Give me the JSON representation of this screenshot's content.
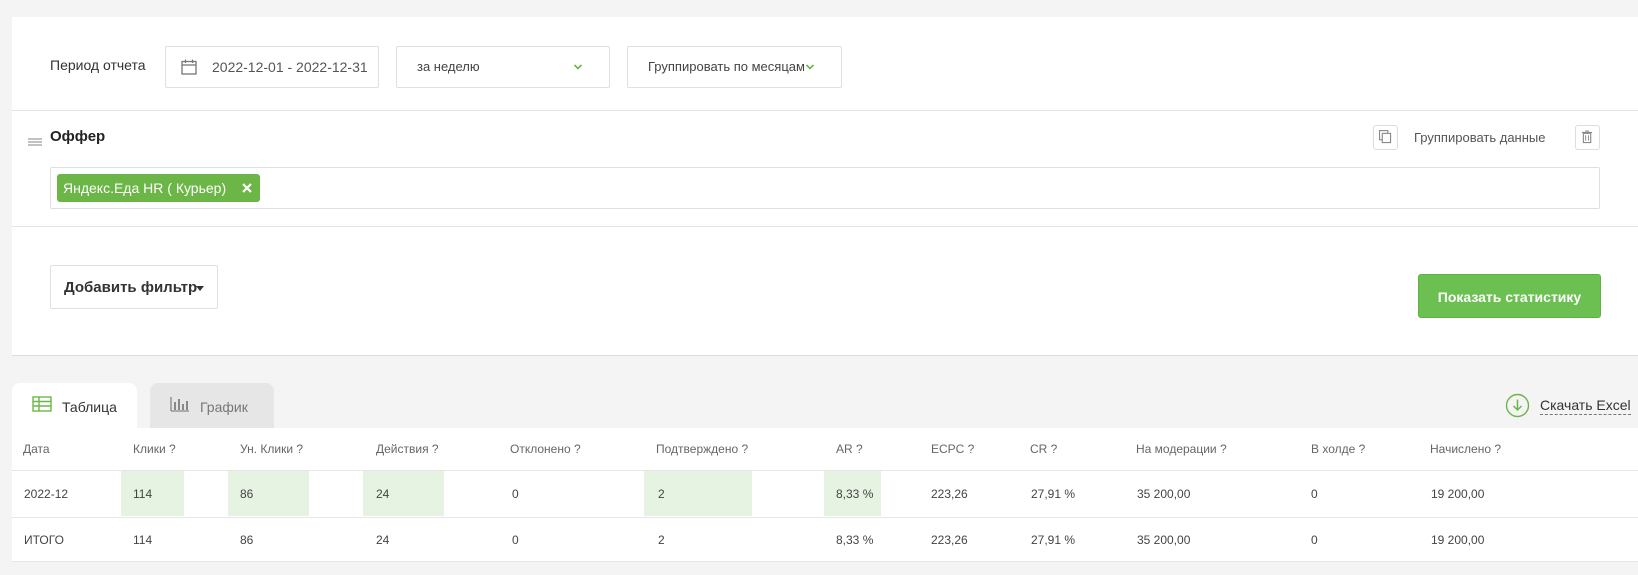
{
  "filters": {
    "period_label": "Период отчета",
    "date_range": "2022-12-01 - 2022-12-31",
    "period_select": "за неделю",
    "group_select": "Группировать по месяцам"
  },
  "offer": {
    "title": "Оффер",
    "group_data_label": "Группировать данные",
    "tag": "Яндекс.Еда HR ( Курьер)"
  },
  "actions": {
    "add_filter": "Добавить фильтр",
    "show_stats": "Показать статистику"
  },
  "tabs": {
    "table": "Таблица",
    "chart": "График"
  },
  "download_label": "Скачать Excel",
  "table": {
    "headers": [
      "Дата",
      "Клики ?",
      "Ун. Клики ?",
      "Действия ?",
      "Отклонено ?",
      "Подтверждено ?",
      "AR ?",
      "ECPC ?",
      "CR ?",
      "На модерации ?",
      "В холде ?",
      "Начислено ?"
    ],
    "rows": [
      [
        "2022-12",
        "114",
        "86",
        "24",
        "0",
        "2",
        "8,33 %",
        "223,26",
        "27,91 %",
        "35 200,00",
        "0",
        "19 200,00"
      ],
      [
        "ИТОГО",
        "114",
        "86",
        "24",
        "0",
        "2",
        "8,33 %",
        "223,26",
        "27,91 %",
        "35 200,00",
        "0",
        "19 200,00"
      ]
    ]
  },
  "colors": {
    "accent": "#6cb647",
    "highlight": "#e6f3e3"
  }
}
